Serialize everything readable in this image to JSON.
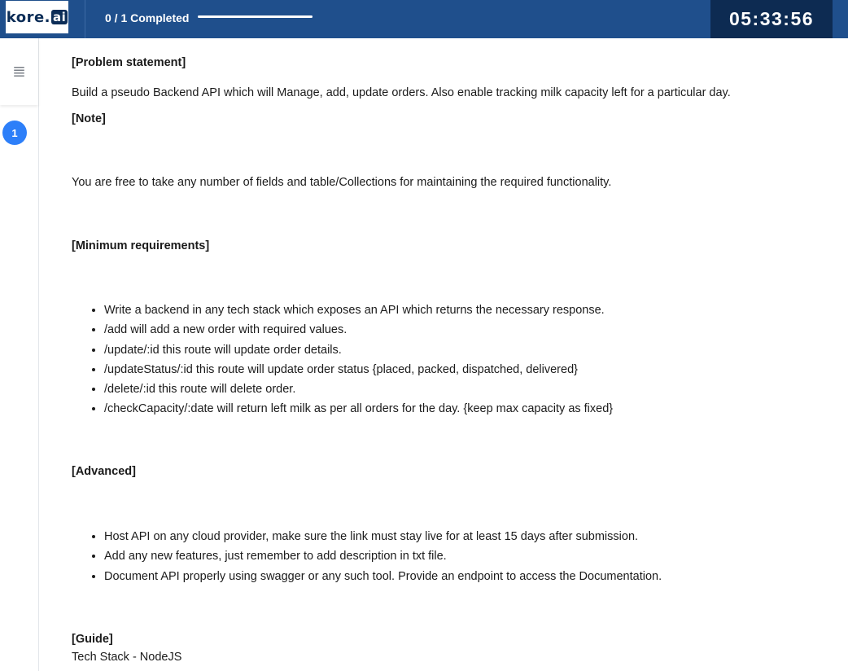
{
  "header": {
    "logo": "kore.ai",
    "logo_text": "kore.",
    "logo_box": "ai",
    "progress_label": "0 / 1 Completed",
    "progress_fraction": 1.0,
    "timer": "05:33:56",
    "colors": {
      "bar": "#1f4f8c",
      "timer_bg": "#0d2b52",
      "accent": "#2d7ff9"
    }
  },
  "sidebar": {
    "menu_icon": "hamburger-icon",
    "menu_glyph": "≣",
    "questions": [
      {
        "number": "1"
      }
    ]
  },
  "content": {
    "problem_heading": "[Problem statement]",
    "problem_text": "Build a pseudo Backend API which will Manage, add, update orders. Also enable tracking milk capacity left for a particular day.",
    "note_heading": "[Note]",
    "note_text": "You are free to take any number of fields and table/Collections for maintaining the required functionality.",
    "min_heading": "[Minimum requirements]",
    "min_items": [
      "Write a backend in any tech stack which exposes an API which returns the necessary response.",
      "/add will add a new order with required values.",
      "/update/:id this route will update order details.",
      "/updateStatus/:id this route will update order status {placed, packed, dispatched, delivered}",
      "/delete/:id this route will delete order.",
      "/checkCapacity/:date will return left milk as per all orders for the day. {keep max capacity as fixed}"
    ],
    "adv_heading": "[Advanced]",
    "adv_items": [
      "Host API on any cloud provider, make sure the link must stay live for at least 15 days after submission.",
      "Add any new features, just remember to add description in txt file.",
      "Document API properly using swagger or any such tool. Provide an endpoint to access the Documentation."
    ],
    "guide_heading": "[Guide]",
    "guide_text": "Tech Stack - NodeJS"
  }
}
